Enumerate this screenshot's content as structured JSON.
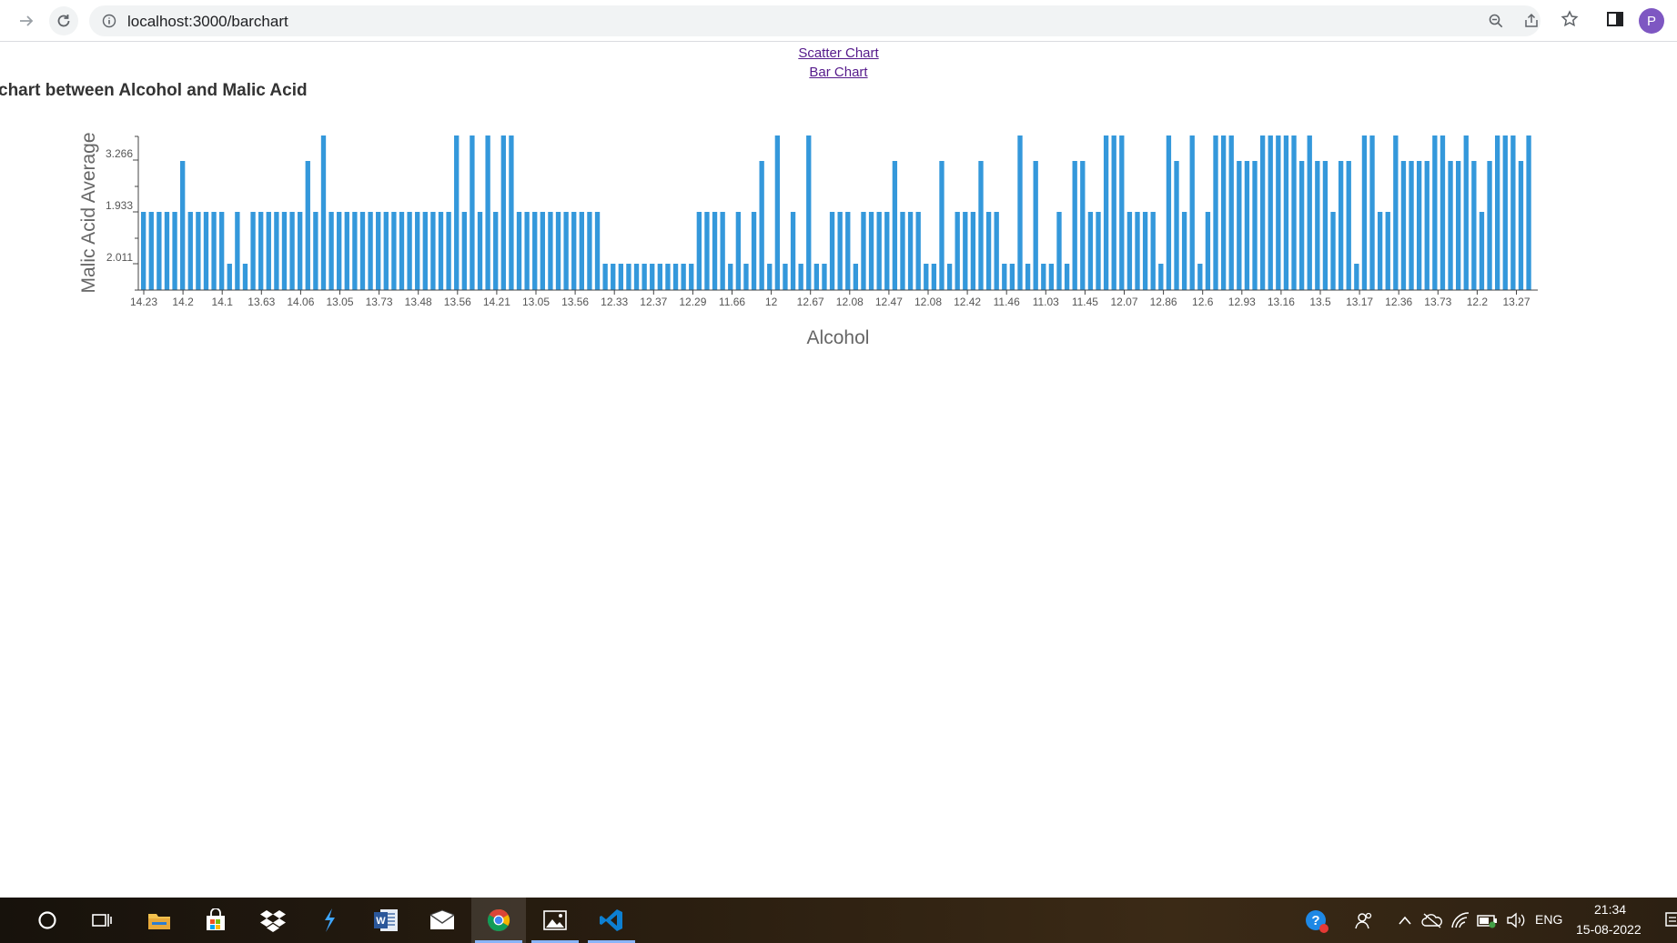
{
  "browser": {
    "url": "localhost:3000/barchart",
    "profile_initial": "P"
  },
  "nav": {
    "scatter_link": "Scatter Chart",
    "bar_link": "Bar Chart"
  },
  "chart_title": "chart between Alcohol and Malic Acid",
  "chart_data": {
    "type": "bar",
    "xlabel": "Alcohol",
    "ylabel": "Malic Acid Average",
    "y_tick_labels": [
      "2.011",
      "1.933",
      "3.266"
    ],
    "x_tick_labels": [
      "14.23",
      "14.2",
      "14.1",
      "13.63",
      "14.06",
      "13.05",
      "13.73",
      "13.48",
      "13.56",
      "14.21",
      "13.05",
      "13.56",
      "12.33",
      "12.37",
      "12.29",
      "11.66",
      "12",
      "12.67",
      "12.08",
      "12.47",
      "12.08",
      "12.42",
      "11.46",
      "11.03",
      "11.45",
      "12.07",
      "12.86",
      "12.6",
      "12.93",
      "13.16",
      "13.5",
      "13.17",
      "12.36",
      "13.73",
      "12.2",
      "13.27"
    ],
    "bar_color": "#3498db",
    "bar_levels": [
      2,
      2,
      2,
      2,
      2,
      3,
      2,
      2,
      2,
      2,
      2,
      1,
      2,
      1,
      2,
      2,
      2,
      2,
      2,
      2,
      2,
      3,
      2,
      4,
      2,
      2,
      2,
      2,
      2,
      2,
      2,
      2,
      2,
      2,
      2,
      2,
      2,
      2,
      2,
      2,
      4,
      2,
      4,
      2,
      4,
      2,
      4,
      4,
      2,
      2,
      2,
      2,
      2,
      2,
      2,
      2,
      2,
      2,
      2,
      1,
      1,
      1,
      1,
      1,
      1,
      1,
      1,
      1,
      1,
      1,
      1,
      2,
      2,
      2,
      2,
      1,
      2,
      1,
      2,
      3,
      1,
      4,
      1,
      2,
      1,
      4,
      1,
      1,
      2,
      2,
      2,
      1,
      2,
      2,
      2,
      2,
      3,
      2,
      2,
      2,
      1,
      1,
      3,
      1,
      2,
      2,
      2,
      3,
      2,
      2,
      1,
      1,
      4,
      1,
      3,
      1,
      1,
      2,
      1,
      3,
      3,
      2,
      2,
      4,
      4,
      4,
      2,
      2,
      2,
      2,
      1,
      4,
      3,
      2,
      4,
      1,
      2,
      4,
      4,
      4,
      3,
      3,
      3,
      4,
      4,
      4,
      4,
      4,
      3,
      4,
      3,
      3,
      2,
      3,
      3,
      1,
      4,
      4,
      2,
      2,
      4,
      3,
      3,
      3,
      3,
      4,
      4,
      3,
      3,
      4,
      3,
      2,
      3,
      4,
      4,
      4,
      3,
      4
    ]
  },
  "taskbar": {
    "time": "21:34",
    "date": "15-08-2022",
    "lang": "ENG"
  }
}
